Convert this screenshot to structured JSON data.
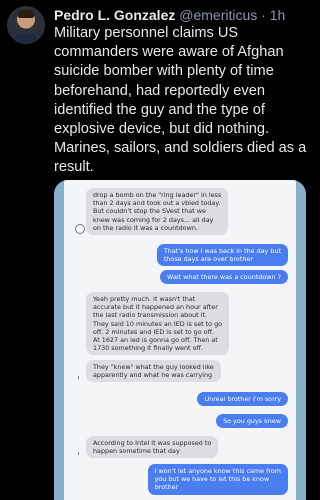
{
  "tweet": {
    "author_name": "Pedro L. Gonzalez",
    "handle": "@emeriticus",
    "separator": "·",
    "time": "1h",
    "text_lines": [
      "Military personnel claims US",
      "commanders were aware of Afghan",
      "suicide bomber with plenty of time",
      "beforehand, had reportedly even",
      "identified the guy and the type of",
      "explosive device, but did nothing.",
      "Marines, sailors, and soldiers died as a",
      "result."
    ]
  },
  "chat": {
    "messages": [
      {
        "side": "in",
        "lines": [
          "drop a bomb on the \"ring leader\" in less",
          "than 2 days and took out a vbied today.",
          "But couldn't stop the SVest that we",
          "knew was coming for 2 days... all day",
          "on the radio it was a countdown."
        ]
      },
      {
        "side": "out",
        "lines": [
          "That's how I was back in the day but",
          "those days are over brother"
        ]
      },
      {
        "side": "out",
        "lines": [
          "Wait what there was a countdown ?"
        ]
      },
      {
        "side": "in",
        "lines": [
          "Yeah pretty much. it wasn't that",
          "accurate but it happened an hour after",
          "the last radio transmission about it.",
          "They said 10 minutes an IED is set to go",
          "off. 2 minutes and IED is set to go off.",
          "At 1627 an ied is gonna go off. Then at",
          "1730 something it finally went off."
        ]
      },
      {
        "side": "in",
        "lines": [
          "They \"knew\" what the guy looked like",
          "apparently and what he was carrying"
        ]
      },
      {
        "side": "out",
        "lines": [
          "Unreal brother I'm sorry"
        ]
      },
      {
        "side": "out",
        "lines": [
          "So you guys knew"
        ]
      },
      {
        "side": "in",
        "lines": [
          "According to Intel it was supposed to",
          "happen sometime that day"
        ]
      },
      {
        "side": "out",
        "lines": [
          "I won't let anyone know this came from",
          "you but we have to let this be know",
          "brother"
        ]
      }
    ]
  }
}
